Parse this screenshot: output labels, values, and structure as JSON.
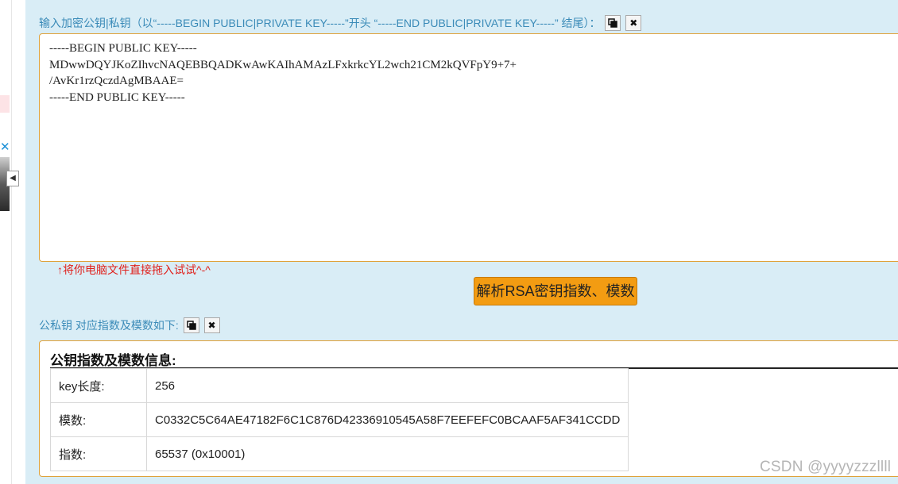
{
  "input_label": "输入加密公钥|私钥（以“-----BEGIN PUBLIC|PRIVATE KEY-----”开头 “-----END PUBLIC|PRIVATE KEY-----” 结尾）：",
  "key_text": "-----BEGIN PUBLIC KEY-----\nMDwwDQYJKoZIhvcNAQEBBQADKwAwKAIhAMAzLFxkrkcYL2wch21CM2kQVFpY9+7+\n/AvKr1rzQczdAgMBAAE=\n-----END PUBLIC KEY-----",
  "hint": "↑将你电脑文件直接拖入试试^-^",
  "parse_button": "解析RSA密钥指数、模数",
  "output_label": "公私钥 对应指数及模数如下:",
  "result": {
    "title": "公钥指数及模数信息:",
    "rows": [
      {
        "key": "key长度:",
        "value": "256"
      },
      {
        "key": "模数:",
        "value": "C0332C5C64AE47182F6C1C876D42336910545A58F7EEFEFC0BCAAF5AF341CCDD"
      },
      {
        "key": "指数:",
        "value": "65537 (0x10001)"
      }
    ]
  },
  "watermark": "CSDN @yyyyzzzllll",
  "icons": {
    "copy": "copy-icon",
    "clear": "close-icon"
  },
  "colors": {
    "panel_bg": "#d9edf6",
    "border": "#e0a23a",
    "button": "#f39c12",
    "label": "#3b8bb8",
    "hint": "#e0201b"
  }
}
